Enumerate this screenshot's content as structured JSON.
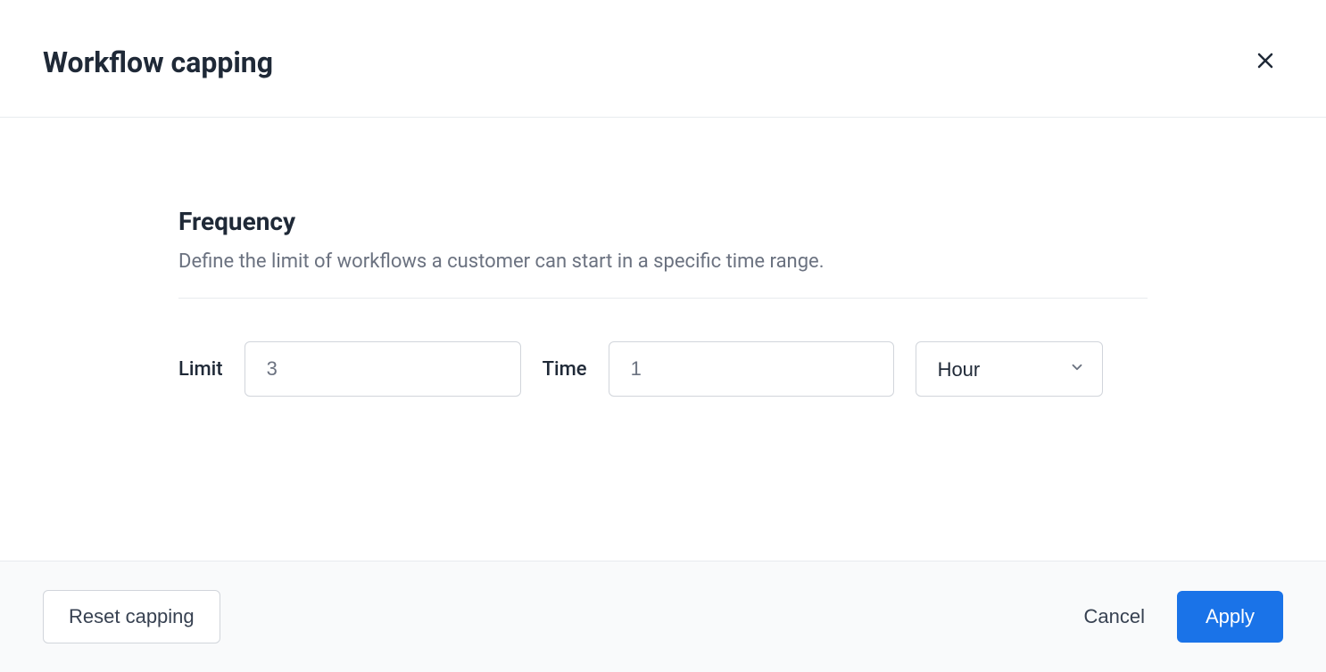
{
  "header": {
    "title": "Workflow capping"
  },
  "body": {
    "section_title": "Frequency",
    "section_description": "Define the limit of workflows a customer can start in a specific time range.",
    "limit_label": "Limit",
    "limit_value": "3",
    "time_label": "Time",
    "time_value": "1",
    "unit_value": "Hour"
  },
  "footer": {
    "reset_label": "Reset capping",
    "cancel_label": "Cancel",
    "apply_label": "Apply"
  }
}
